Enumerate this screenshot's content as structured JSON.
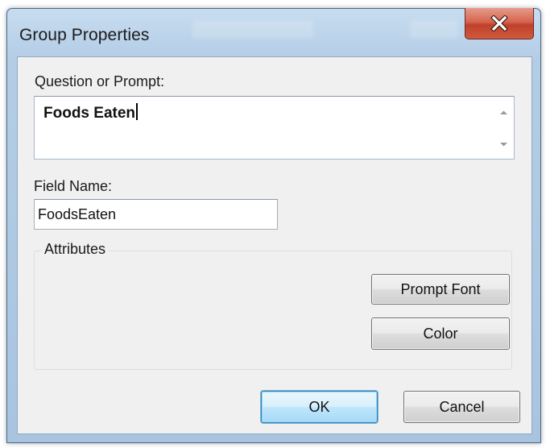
{
  "window": {
    "title": "Group Properties"
  },
  "titlebar": {
    "close_icon": "close-x-icon"
  },
  "prompt": {
    "label": "Question or Prompt:",
    "value": "Foods Eaten",
    "scroll_up_icon": "scroll-up-arrow-icon",
    "scroll_down_icon": "scroll-down-arrow-icon"
  },
  "field": {
    "label": "Field Name:",
    "value": "FoodsEaten"
  },
  "attributes": {
    "legend": "Attributes",
    "prompt_font_label": "Prompt Font",
    "color_label": "Color"
  },
  "footer": {
    "ok_label": "OK",
    "cancel_label": "Cancel"
  },
  "colors": {
    "dialog_background": "#f0f0f0",
    "titlebar_glass": "#b3cde6",
    "close_button": "#c7432c",
    "default_button_border": "#3c7fb1"
  }
}
